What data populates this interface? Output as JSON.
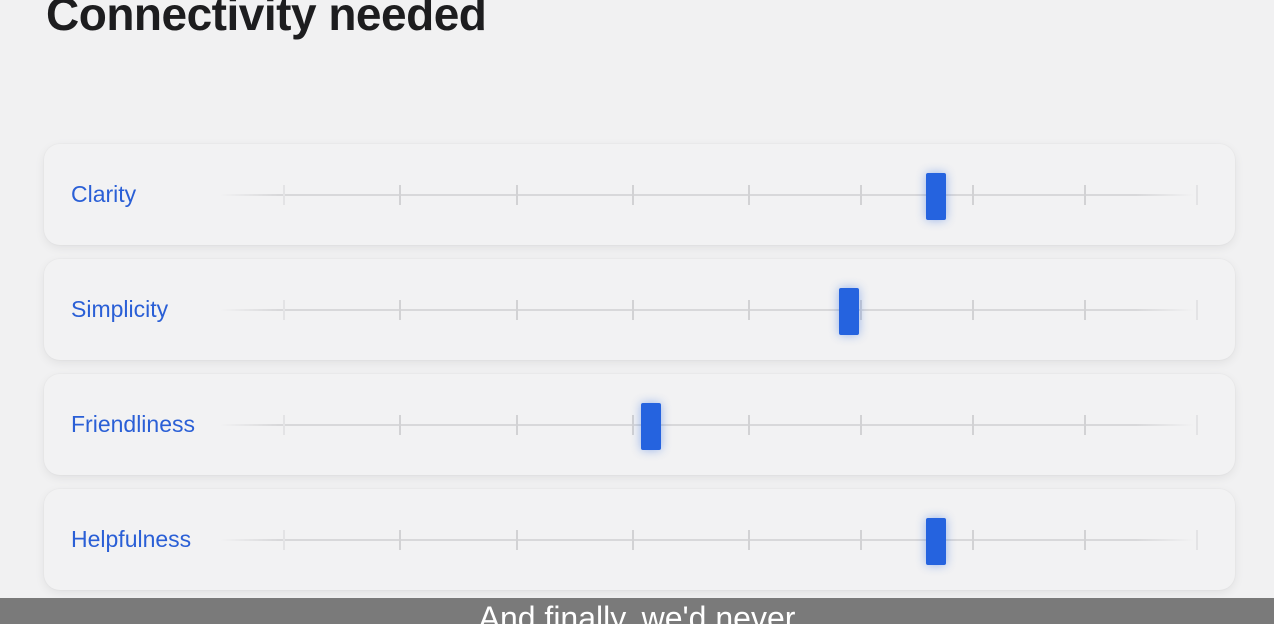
{
  "page": {
    "title": "Connectivity needed"
  },
  "sliders": [
    {
      "label": "Clarity",
      "value": 0.7143
    },
    {
      "label": "Simplicity",
      "value": 0.6186
    },
    {
      "label": "Friendliness",
      "value": 0.4023
    },
    {
      "label": "Helpfulness",
      "value": 0.7143
    }
  ],
  "scale": {
    "tick_count": 9
  },
  "caption": {
    "text": "And finally, we'd never"
  },
  "colors": {
    "accent": "#2563df",
    "label": "#2a5fd6",
    "background": "#f1f1f2",
    "card": "#f2f2f3",
    "caption_bar": "#7a7a7a"
  }
}
